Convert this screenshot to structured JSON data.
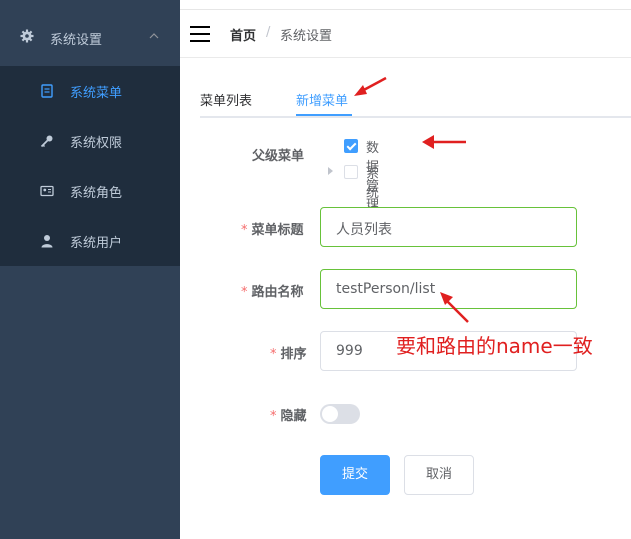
{
  "sidebar": {
    "group_title": "系统设置",
    "items": [
      {
        "label": "系统菜单",
        "icon": "document-icon",
        "active": true
      },
      {
        "label": "系统权限",
        "icon": "key-icon",
        "active": false
      },
      {
        "label": "系统角色",
        "icon": "id-card-icon",
        "active": false
      },
      {
        "label": "系统用户",
        "icon": "user-icon",
        "active": false
      }
    ]
  },
  "header": {
    "breadcrumb_home": "首页",
    "breadcrumb_sep": "/",
    "breadcrumb_current": "系统设置"
  },
  "tabs": [
    {
      "label": "菜单列表",
      "active": false
    },
    {
      "label": "新增菜单",
      "active": true
    }
  ],
  "form": {
    "parent_label": "父级菜单",
    "tree": [
      {
        "label": "数据管理",
        "checked": true,
        "has_arrow": false
      },
      {
        "label": "系统设置",
        "checked": false,
        "has_arrow": true
      }
    ],
    "title_label": "菜单标题",
    "title_value": "人员列表",
    "route_label": "路由名称",
    "route_value": "testPerson/list",
    "order_label": "排序",
    "order_value": "999",
    "hidden_label": "隐藏",
    "hidden_value": false,
    "required_mark": "*",
    "submit_label": "提交",
    "cancel_label": "取消"
  },
  "annotation": {
    "text": "要和路由的name一致",
    "color": "#e02020"
  },
  "colors": {
    "sidebar_bg": "#304156",
    "submenu_bg": "#1f2d3d",
    "accent": "#409eff",
    "valid_border": "#67c23a"
  }
}
